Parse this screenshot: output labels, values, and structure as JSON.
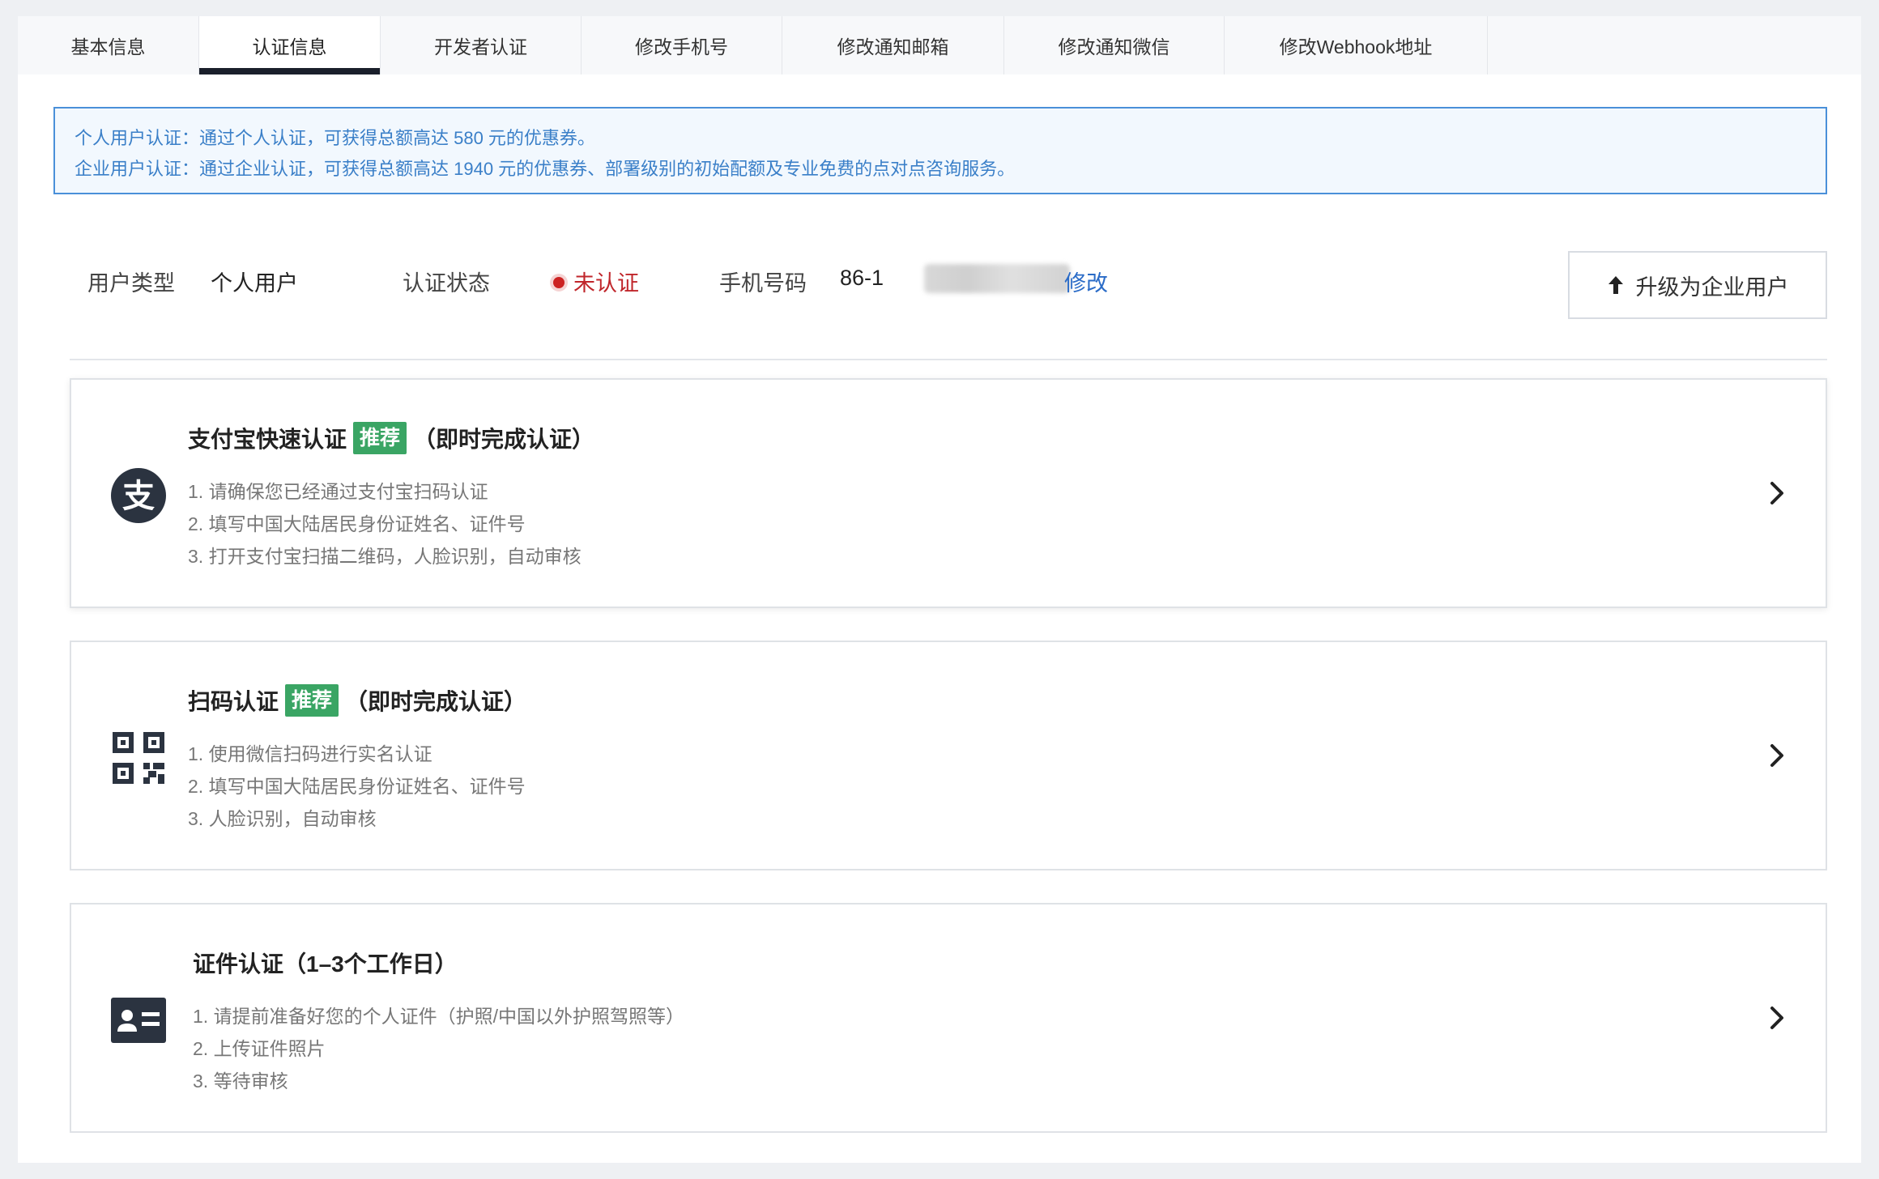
{
  "tabs": [
    {
      "label": "基本信息",
      "active": false
    },
    {
      "label": "认证信息",
      "active": true
    },
    {
      "label": "开发者认证",
      "active": false
    },
    {
      "label": "修改手机号",
      "active": false
    },
    {
      "label": "修改通知邮箱",
      "active": false
    },
    {
      "label": "修改通知微信",
      "active": false
    },
    {
      "label": "修改Webhook地址",
      "active": false
    }
  ],
  "notice": {
    "line1": "个人用户认证：通过个人认证，可获得总额高达 580 元的优惠券。",
    "line2": "企业用户认证：通过企业认证，可获得总额高达 1940 元的优惠券、部署级别的初始配额及专业免费的点对点咨询服务。"
  },
  "info": {
    "user_type_label": "用户类型",
    "user_type_value": "个人用户",
    "status_label": "认证状态",
    "status_value": "未认证",
    "phone_label": "手机号码",
    "phone_value": "86-1",
    "modify_label": "修改",
    "upgrade_label": "升级为企业用户"
  },
  "colors": {
    "accent_tab": "#1a1f2b",
    "notice_border": "#4a90d9",
    "notice_text": "#3a7fc8",
    "status_red": "#c0262b",
    "link_blue": "#2a6bc7",
    "badge_green": "#3aa564"
  },
  "cards": [
    {
      "icon": "alipay-icon",
      "title": "支付宝快速认证",
      "badge": "推荐",
      "suffix": "（即时完成认证）",
      "steps": [
        "1. 请确保您已经通过支付宝扫码认证",
        "2. 填写中国大陆居民身份证姓名、证件号",
        "3. 打开支付宝扫描二维码，人脸识别，自动审核"
      ]
    },
    {
      "icon": "qr-code-icon",
      "title": "扫码认证",
      "badge": "推荐",
      "suffix": "（即时完成认证）",
      "steps": [
        "1. 使用微信扫码进行实名认证",
        "2. 填写中国大陆居民身份证姓名、证件号",
        "3. 人脸识别，自动审核"
      ]
    },
    {
      "icon": "id-card-icon",
      "title": "证件认证（1–3个工作日）",
      "badge": "",
      "suffix": "",
      "steps": [
        "1. 请提前准备好您的个人证件（护照/中国以外护照驾照等）",
        "2. 上传证件照片",
        "3. 等待审核"
      ]
    }
  ]
}
